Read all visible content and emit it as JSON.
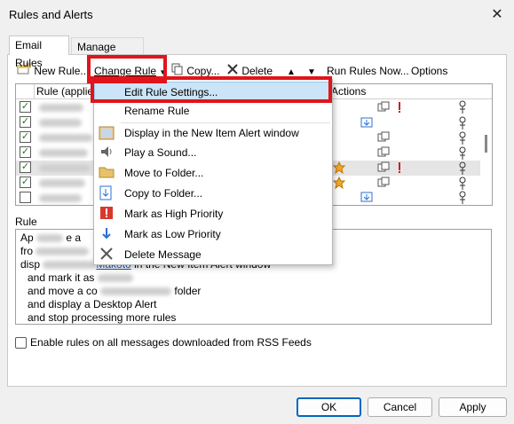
{
  "window": {
    "title": "Rules and Alerts",
    "close_glyph": "✕"
  },
  "tabs": [
    {
      "label": "Email Rules",
      "active": true
    },
    {
      "label": "Manage Alerts",
      "active": false
    }
  ],
  "toolbar": {
    "new_rule": "New Rule...",
    "change_rule": "Change Rule",
    "copy": "Copy...",
    "delete": "Delete",
    "run_rules_now": "Run Rules Now...",
    "options": "Options"
  },
  "rules_list": {
    "column_rule": "Rule (applied",
    "column_actions": "Actions",
    "rows": [
      {
        "checked": true,
        "partial_text": "y"
      },
      {
        "checked": true,
        "partial_text": "st"
      },
      {
        "checked": true,
        "partial_text": ""
      },
      {
        "checked": true,
        "partial_text": ""
      },
      {
        "checked": true,
        "partial_text": "nd",
        "selected": true
      },
      {
        "checked": true,
        "partial_text": "ot"
      },
      {
        "checked": false,
        "partial_text": "ert"
      }
    ]
  },
  "context_menu": {
    "items": [
      {
        "label": "Edit Rule Settings...",
        "icon": "none",
        "highlighted": true
      },
      {
        "label": "Rename Rule",
        "icon": "none"
      },
      {
        "label": "Display in the New Item Alert window",
        "icon": "alert-window-icon"
      },
      {
        "label": "Play a Sound...",
        "icon": "speaker-icon"
      },
      {
        "label": "Move to Folder...",
        "icon": "folder-icon"
      },
      {
        "label": "Copy to Folder...",
        "icon": "copy-folder-icon"
      },
      {
        "label": "Mark as High Priority",
        "icon": "high-priority-icon"
      },
      {
        "label": "Mark as Low Priority",
        "icon": "low-priority-icon"
      },
      {
        "label": "Delete Message",
        "icon": "delete-x-icon"
      }
    ]
  },
  "description": {
    "label": "Rule",
    "lines": {
      "l1": "Ap",
      "l1b": "e a",
      "l2": "fro",
      "l3": "disp",
      "l3b": "in the New Item Alert window",
      "l3link": "Makoto",
      "l4": "and mark it as",
      "l5a": "and move a co",
      "l5b": "folder",
      "l6": "and display a Desktop Alert",
      "l7": "and stop processing more rules"
    }
  },
  "rss": {
    "label": "Enable rules on all messages downloaded from RSS Feeds",
    "checked": false
  },
  "buttons": {
    "ok": "OK",
    "cancel": "Cancel",
    "apply": "Apply"
  },
  "colors": {
    "highlight_box": "#e0141b",
    "menu_highlight": "#cce4f7",
    "link": "#1a56b0",
    "check_green": "#1a7d1a"
  }
}
